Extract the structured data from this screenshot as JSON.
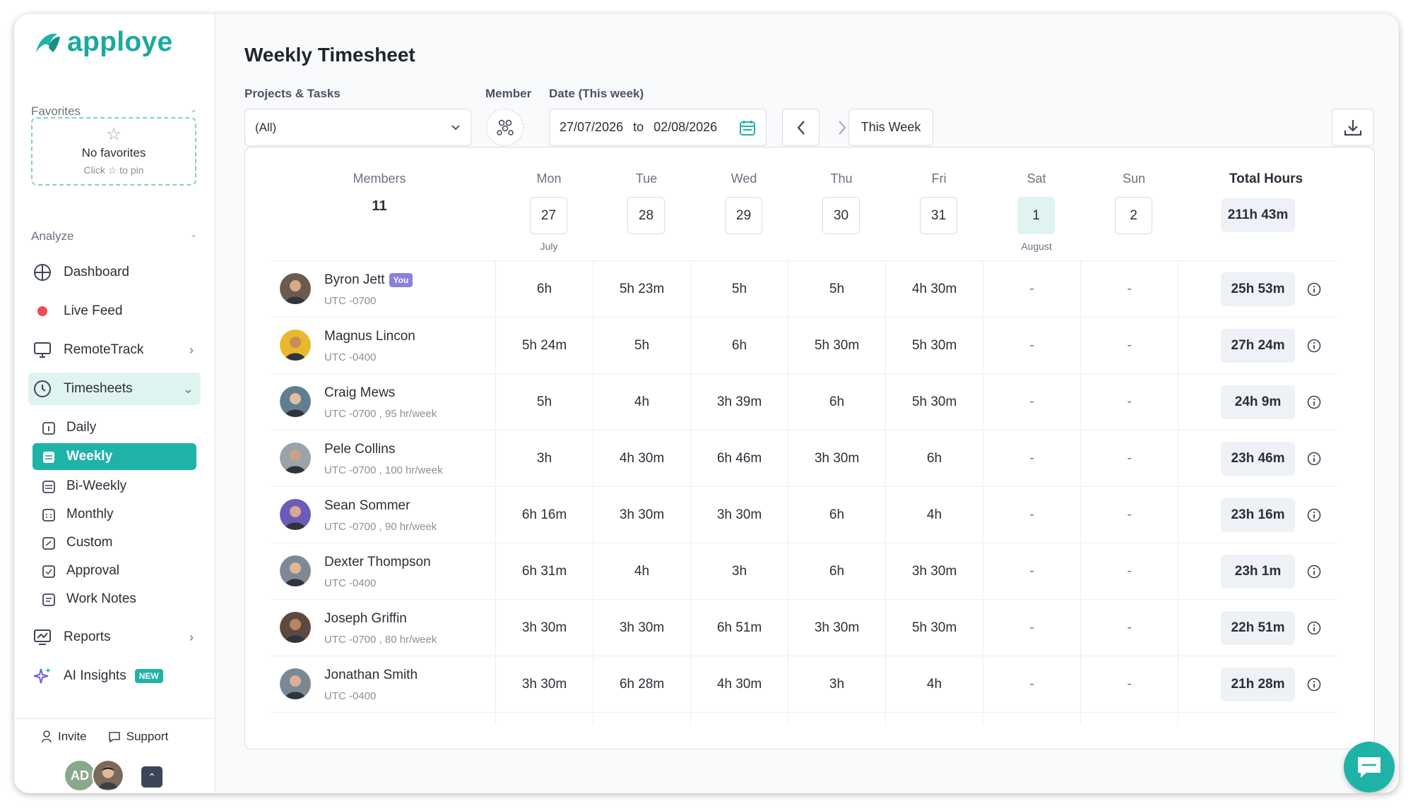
{
  "brand": {
    "name": "apploye",
    "accent": "#1fb3a8"
  },
  "sidebar": {
    "favorites": {
      "label": "Favorites",
      "empty_title": "No favorites",
      "empty_hint": "Click ☆ to pin"
    },
    "analyze": {
      "label": "Analyze"
    },
    "nav": [
      {
        "label": "Dashboard",
        "icon": "dashboard-icon"
      },
      {
        "label": "Live Feed",
        "icon": "live-dot-icon"
      },
      {
        "label": "RemoteTrack",
        "icon": "monitor-icon"
      },
      {
        "label": "Timesheets",
        "icon": "clock-icon"
      }
    ],
    "timesheet_sub": [
      {
        "label": "Daily"
      },
      {
        "label": "Weekly"
      },
      {
        "label": "Bi-Weekly"
      },
      {
        "label": "Monthly"
      },
      {
        "label": "Custom"
      },
      {
        "label": "Approval"
      },
      {
        "label": "Work Notes"
      }
    ],
    "reports": "Reports",
    "ai_insights": "AI Insights",
    "new_badge": "NEW",
    "invite": "Invite",
    "support": "Support",
    "user_initials": "AD"
  },
  "header": {
    "title": "Weekly Timesheet"
  },
  "filters": {
    "projects_label": "Projects & Tasks",
    "projects_value": "(All)",
    "member_label": "Member",
    "date_label": "Date (This week)",
    "date_from": "27/07/2026",
    "date_to_word": "to",
    "date_to": "02/08/2026",
    "this_week": "This Week"
  },
  "table": {
    "members_label": "Members",
    "members_count": "11",
    "days": [
      {
        "name": "Mon",
        "date": "27",
        "month": "July"
      },
      {
        "name": "Tue",
        "date": "28",
        "month": ""
      },
      {
        "name": "Wed",
        "date": "29",
        "month": ""
      },
      {
        "name": "Thu",
        "date": "30",
        "month": ""
      },
      {
        "name": "Fri",
        "date": "31",
        "month": ""
      },
      {
        "name": "Sat",
        "date": "1",
        "month": "August"
      },
      {
        "name": "Sun",
        "date": "2",
        "month": ""
      }
    ],
    "total_label": "Total Hours",
    "grand_total": "211h 43m",
    "rows": [
      {
        "name": "Byron Jett",
        "you": "You",
        "tz": "UTC -0700",
        "hours": [
          "6h",
          "5h 23m",
          "5h",
          "5h",
          "4h 30m",
          "-",
          "-"
        ],
        "total": "25h 53m"
      },
      {
        "name": "Magnus Lincon",
        "you": "",
        "tz": "UTC -0400",
        "hours": [
          "5h 24m",
          "5h",
          "6h",
          "5h 30m",
          "5h 30m",
          "-",
          "-"
        ],
        "total": "27h 24m"
      },
      {
        "name": "Craig Mews",
        "you": "",
        "tz": "UTC -0700 , 95 hr/week",
        "hours": [
          "5h",
          "4h",
          "3h 39m",
          "6h",
          "5h 30m",
          "-",
          "-"
        ],
        "total": "24h 9m"
      },
      {
        "name": "Pele Collins",
        "you": "",
        "tz": "UTC -0700 , 100 hr/week",
        "hours": [
          "3h",
          "4h 30m",
          "6h 46m",
          "3h 30m",
          "6h",
          "-",
          "-"
        ],
        "total": "23h 46m"
      },
      {
        "name": "Sean Sommer",
        "you": "",
        "tz": "UTC -0700 , 90 hr/week",
        "hours": [
          "6h 16m",
          "3h 30m",
          "3h 30m",
          "6h",
          "4h",
          "-",
          "-"
        ],
        "total": "23h 16m"
      },
      {
        "name": "Dexter Thompson",
        "you": "",
        "tz": "UTC -0400",
        "hours": [
          "6h 31m",
          "4h",
          "3h",
          "6h",
          "3h 30m",
          "-",
          "-"
        ],
        "total": "23h 1m"
      },
      {
        "name": "Joseph Griffin",
        "you": "",
        "tz": "UTC -0700 , 80 hr/week",
        "hours": [
          "3h 30m",
          "3h 30m",
          "6h 51m",
          "3h 30m",
          "5h 30m",
          "-",
          "-"
        ],
        "total": "22h 51m"
      },
      {
        "name": "Jonathan Smith",
        "you": "",
        "tz": "UTC -0400",
        "hours": [
          "3h 30m",
          "6h 28m",
          "4h 30m",
          "3h",
          "4h",
          "-",
          "-"
        ],
        "total": "21h 28m"
      }
    ]
  }
}
